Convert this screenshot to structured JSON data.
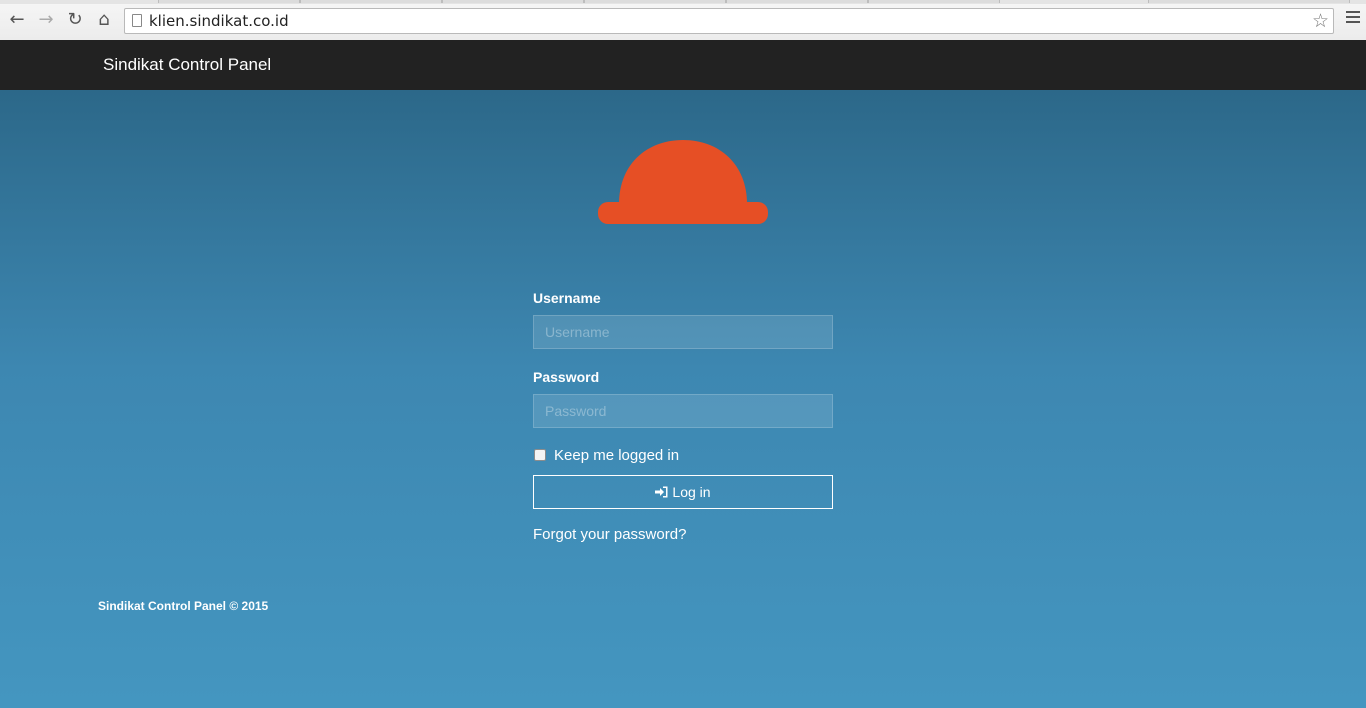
{
  "browser": {
    "url": "klien.sindikat.co.id",
    "back_icon": "←",
    "forward_icon": "→",
    "reload_icon": "↻",
    "home_icon": "⌂",
    "star_icon": "☆"
  },
  "header": {
    "title": "Sindikat Control Panel"
  },
  "login": {
    "username_label": "Username",
    "username_placeholder": "Username",
    "username_value": "",
    "password_label": "Password",
    "password_placeholder": "Password",
    "password_value": "",
    "remember_label": "Keep me logged in",
    "remember_checked": false,
    "login_button": "Log in",
    "forgot_link": "Forgot your password?"
  },
  "footer": {
    "text": "Sindikat Control Panel © 2015"
  },
  "colors": {
    "header_bg": "#222222",
    "logo": "#e64f25",
    "bg_top": "#2c6889",
    "bg_bottom": "#4496c0"
  },
  "icons": {
    "logo": "hard-hat-logo",
    "login_button": "sign-in-icon"
  }
}
